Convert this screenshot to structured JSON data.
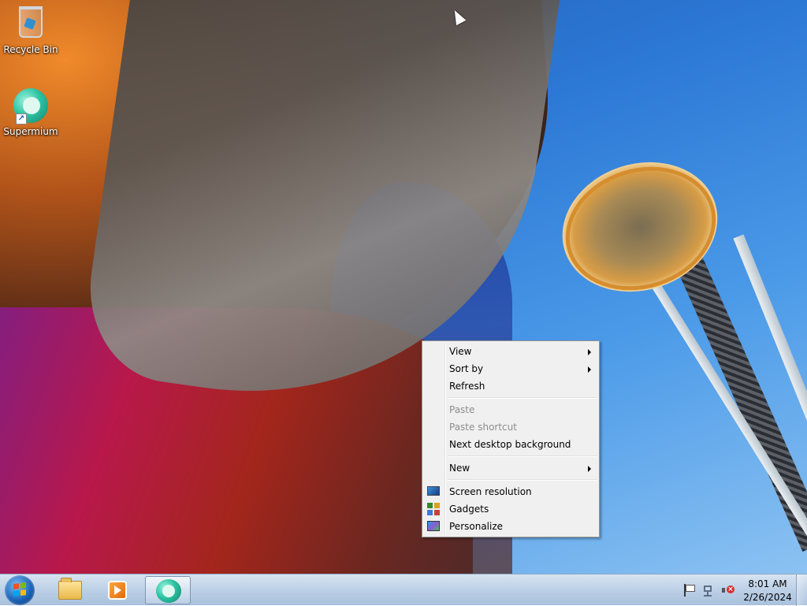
{
  "desktop": {
    "icons": [
      {
        "label": "Recycle Bin",
        "icon": "recycle-bin-icon"
      },
      {
        "label": "Supermium",
        "icon": "supermium-icon"
      }
    ]
  },
  "context_menu": {
    "items": [
      {
        "label": "View",
        "submenu": true,
        "enabled": true
      },
      {
        "label": "Sort by",
        "submenu": true,
        "enabled": true
      },
      {
        "label": "Refresh",
        "enabled": true
      },
      {
        "label": "Paste",
        "enabled": false
      },
      {
        "label": "Paste shortcut",
        "enabled": false
      },
      {
        "label": "Next desktop background",
        "enabled": true
      },
      {
        "label": "New",
        "submenu": true,
        "enabled": true
      },
      {
        "label": "Screen resolution",
        "icon": "monitor-icon",
        "enabled": true
      },
      {
        "label": "Gadgets",
        "icon": "gadgets-icon",
        "enabled": true
      },
      {
        "label": "Personalize",
        "icon": "personalize-icon",
        "enabled": true
      }
    ]
  },
  "taskbar": {
    "pinned": [
      {
        "name": "Windows Explorer",
        "icon": "folder-icon"
      },
      {
        "name": "Windows Media Player",
        "icon": "media-player-icon"
      },
      {
        "name": "Supermium",
        "icon": "supermium-icon",
        "active": true
      }
    ],
    "tray": {
      "icons": [
        "action-center-flag-icon",
        "network-icon",
        "volume-muted-icon"
      ],
      "time": "8:01 AM",
      "date": "2/26/2024"
    }
  }
}
